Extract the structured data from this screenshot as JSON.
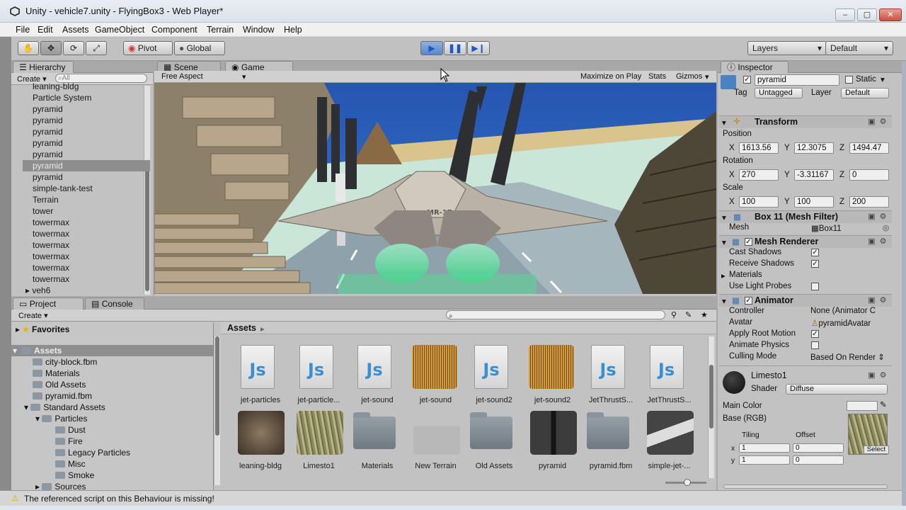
{
  "window": {
    "title": "Unity - vehicle7.unity - FlyingBox3 - Web Player*",
    "buttons": [
      "–",
      "▢",
      "✕"
    ]
  },
  "menu": [
    "File",
    "Edit",
    "Assets",
    "GameObject",
    "Component",
    "Terrain",
    "Window",
    "Help"
  ],
  "toolbar": {
    "pivot": "Pivot",
    "global": "Global",
    "layers": "Layers",
    "layout": "Default"
  },
  "hierarchy": {
    "tab": "Hierarchy",
    "create": "Create",
    "search_placeholder": "All",
    "items": [
      "leaning-bldg",
      "Particle System",
      "pyramid",
      "pyramid",
      "pyramid",
      "pyramid",
      "pyramid",
      "pyramid",
      "pyramid",
      "simple-tank-test",
      "Terrain",
      "tower",
      "towermax",
      "towermax",
      "towermax",
      "towermax",
      "towermax",
      "towermax",
      "veh6"
    ],
    "selected_index": 7
  },
  "scene_tabs": {
    "scene": "Scene",
    "game": "Game"
  },
  "game_bar": {
    "aspect": "Free Aspect",
    "maximize": "Maximize on Play",
    "stats": "Stats",
    "gizmos": "Gizmos"
  },
  "game_view": {
    "plane_label": "MR-17"
  },
  "project": {
    "tab": "Project",
    "console_tab": "Console",
    "create": "Create",
    "favorites": "Favorites",
    "assets": "Assets",
    "tree": [
      "city-block.fbm",
      "Materials",
      "Old Assets",
      "pyramid.fbm",
      "Standard Assets",
      "Particles",
      "Dust",
      "Fire",
      "Legacy Particles",
      "Misc",
      "Smoke",
      "Sources"
    ],
    "breadcrumb": "Assets",
    "row1": [
      {
        "name": "jet-particles",
        "kind": "js"
      },
      {
        "name": "jet-particle...",
        "kind": "js"
      },
      {
        "name": "jet-sound",
        "kind": "js"
      },
      {
        "name": "jet-sound",
        "kind": "audio"
      },
      {
        "name": "jet-sound2",
        "kind": "js"
      },
      {
        "name": "jet-sound2",
        "kind": "audio"
      },
      {
        "name": "JetThrustS...",
        "kind": "js"
      },
      {
        "name": "JetThrustS...",
        "kind": "js"
      }
    ],
    "row2": [
      {
        "name": "leaning-bldg",
        "kind": "model"
      },
      {
        "name": "Limesto1",
        "kind": "texture"
      },
      {
        "name": "Materials",
        "kind": "folder"
      },
      {
        "name": "New Terrain",
        "kind": "terrain"
      },
      {
        "name": "Old Assets",
        "kind": "folder"
      },
      {
        "name": "pyramid",
        "kind": "pyramid"
      },
      {
        "name": "pyramid.fbm",
        "kind": "folder"
      },
      {
        "name": "simple-jet-...",
        "kind": "jet"
      }
    ]
  },
  "inspector": {
    "tab": "Inspector",
    "name": "pyramid",
    "static": "Static",
    "tag_label": "Tag",
    "tag": "Untagged",
    "layer_label": "Layer",
    "layer": "Default",
    "transform": {
      "title": "Transform",
      "position": "Position",
      "rotation": "Rotation",
      "scale": "Scale",
      "pos": [
        "1613.56",
        "12.3075",
        "1494.47"
      ],
      "rot": [
        "270",
        "-3.31167",
        "0"
      ],
      "scl": [
        "100",
        "100",
        "200"
      ]
    },
    "mesh_filter": {
      "title": "Box 11 (Mesh Filter)",
      "mesh_label": "Mesh",
      "mesh": "Box11"
    },
    "mesh_renderer": {
      "title": "Mesh Renderer",
      "cast": "Cast Shadows",
      "receive": "Receive Shadows",
      "materials": "Materials",
      "probes": "Use Light Probes"
    },
    "animator": {
      "title": "Animator",
      "controller_label": "Controller",
      "controller": "None (Animator C",
      "avatar_label": "Avatar",
      "avatar": "pyramidAvatar",
      "root": "Apply Root Motion",
      "physics": "Animate Physics",
      "culling_label": "Culling Mode",
      "culling": "Based On Render"
    },
    "material": {
      "name": "Limesto1",
      "shader_label": "Shader",
      "shader": "Diffuse",
      "main_color": "Main Color",
      "base": "Base (RGB)",
      "tiling": "Tiling",
      "offset": "Offset",
      "tx": "1",
      "ty": "1",
      "ox": "0",
      "oy": "0",
      "select": "Select"
    }
  },
  "status": {
    "message": "The referenced script on this Behaviour is missing!"
  },
  "colors": {
    "panel": "#c2c2c2",
    "sky": "#2b5fb8",
    "selection": "#8e8e8e",
    "js": "#3b8fd1"
  }
}
